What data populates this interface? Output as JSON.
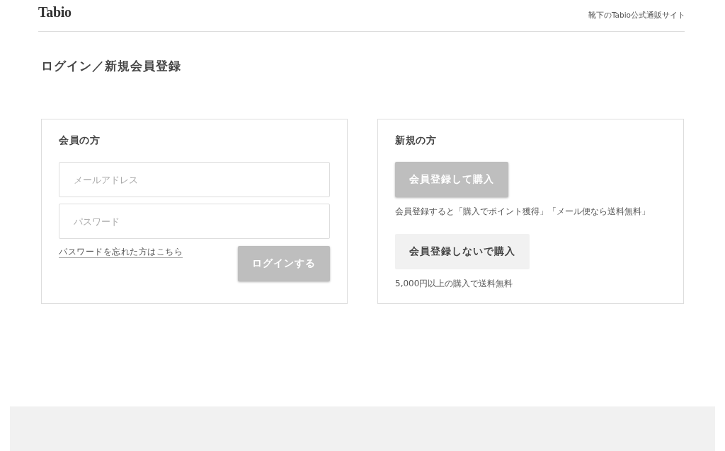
{
  "header": {
    "logo": "Tabio",
    "tagline": "靴下のTabio公式通販サイト"
  },
  "page_title": "ログイン／新規会員登録",
  "member_panel": {
    "title": "会員の方",
    "fields": [
      {
        "placeholder": "メールアドレス"
      },
      {
        "placeholder": "パスワード"
      }
    ],
    "forgot_link": "パスワードを忘れた方はこちら",
    "login_button": {
      "label": "ログインする",
      "kind": "primary"
    }
  },
  "new_panel": {
    "title": "新規の方",
    "options": [
      {
        "button": {
          "label": "会員登録して購入",
          "kind": "primary"
        },
        "note": "会員登録すると「購入でポイント獲得」「メール便なら送料無料」"
      },
      {
        "button": {
          "label": "会員登録しないで購入",
          "kind": "secondary"
        },
        "note": "5,000円以上の購入で送料無料"
      }
    ]
  }
}
